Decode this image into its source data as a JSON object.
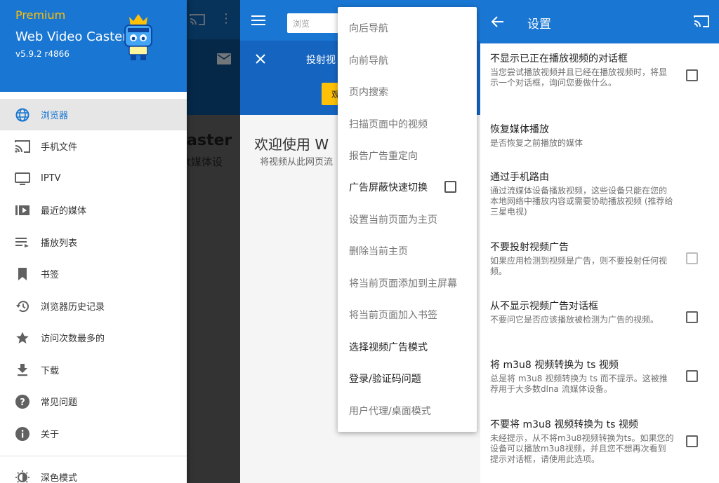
{
  "drawer": {
    "badge": "Premium",
    "app_name": "Web Video Caster",
    "version": "v5.9.2 r4866",
    "items": [
      {
        "label": "浏览器",
        "icon": "globe-icon",
        "active": true
      },
      {
        "label": "手机文件",
        "icon": "cast-icon"
      },
      {
        "label": "IPTV",
        "icon": "tv-icon"
      },
      {
        "label": "最近的媒体",
        "icon": "recent-media-icon"
      },
      {
        "label": "播放列表",
        "icon": "playlist-icon"
      },
      {
        "label": "书签",
        "icon": "bookmark-icon"
      },
      {
        "label": "浏览器历史记录",
        "icon": "history-icon"
      },
      {
        "label": "访问次数最多的",
        "icon": "star-icon"
      },
      {
        "label": "下载",
        "icon": "download-icon"
      },
      {
        "label": "常见问题",
        "icon": "help-icon"
      },
      {
        "label": "关于",
        "icon": "info-icon"
      },
      {
        "label": "深色模式",
        "icon": "dark-mode-icon"
      }
    ],
    "background_title": "aster",
    "background_subtitle": "t媒体设"
  },
  "browser": {
    "url_placeholder": "浏览",
    "banner_text": "投射视",
    "banner_button": "观",
    "welcome_title": "欢迎使用 W",
    "welcome_subtitle": "将视频从此网页流",
    "menu": [
      {
        "label": "向后导航"
      },
      {
        "label": "向前导航"
      },
      {
        "label": "页内搜索"
      },
      {
        "label": "扫描页面中的视频"
      },
      {
        "label": "报告广告重定向"
      },
      {
        "label": "广告屏蔽快速切换",
        "strong": true,
        "checkbox": false
      },
      {
        "label": "设置当前页面为主页"
      },
      {
        "label": "删除当前主页"
      },
      {
        "label": "将当前页面添加到主屏幕"
      },
      {
        "label": "将当前页面加入书签"
      },
      {
        "label": "选择视频广告模式",
        "strong": true
      },
      {
        "label": "登录/验证码问题",
        "strong": true
      },
      {
        "label": "用户代理/桌面模式"
      }
    ]
  },
  "settings": {
    "title": "设置",
    "items": [
      {
        "title": "不显示已正在播放视频的对话框",
        "desc": "当您尝试播放视频并且已经在播放视频时，将显示一个对话框，询问您要做什么。",
        "checked": false,
        "enabled": true
      },
      {
        "title": "恢复媒体播放",
        "desc": "是否恢复之前播放的媒体"
      },
      {
        "title": "通过手机路由",
        "desc": "通过流媒体设备播放视频，这些设备只能在您的本地网络中播放内容或需要协助播放视频 (推荐给三星电视)"
      },
      {
        "title": "不要投射视频广告",
        "desc": "如果应用检测到视频是广告，则不要投射任何视频。",
        "checked": false,
        "enabled": false
      },
      {
        "title": "从不显示视频广告对话框",
        "desc": "不要问它是否应该播放被检测为广告的视频。",
        "checked": false,
        "enabled": true
      },
      {
        "title": "将 m3u8 视频转换为 ts 视频",
        "desc": "总是将 m3u8 视频转换为 ts 而不提示。这被推荐用于大多数dlna 流媒体设备。",
        "checked": false,
        "enabled": true
      },
      {
        "title": "不要将 m3u8 视频转换为 ts 视频",
        "desc": "未经提示，从不将m3u8视频转换为ts。如果您的设备可以播放m3u8视频，并且您不想再次看到提示对话框，请使用此选项。",
        "checked": false,
        "enabled": true
      }
    ]
  },
  "colors": {
    "primary": "#1976d2",
    "accent_yellow": "#ffc107",
    "active_item_bg": "#e6e6e6"
  }
}
